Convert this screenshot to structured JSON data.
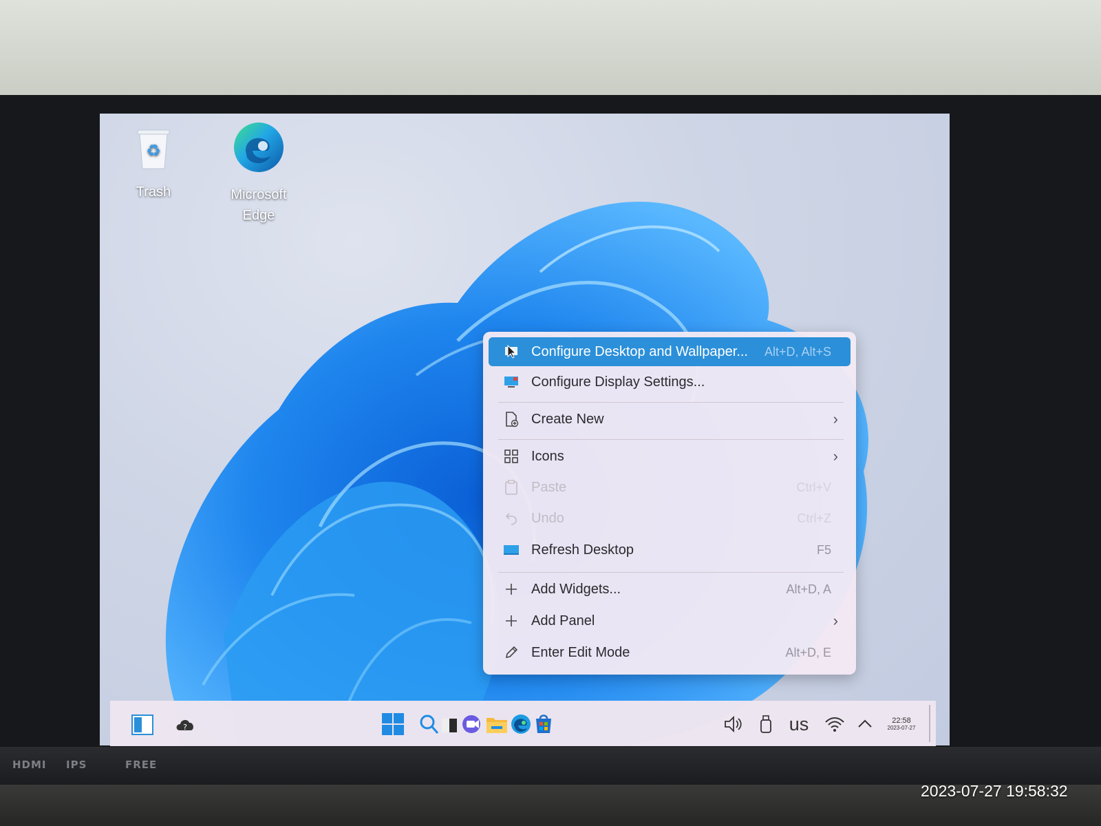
{
  "desktop": {
    "icons": [
      {
        "label": "Trash",
        "icon": "recycle-bin-icon"
      },
      {
        "label": "Microsoft Edge",
        "icon": "edge-icon"
      }
    ]
  },
  "context_menu": {
    "items": [
      {
        "label": "Configure Desktop and Wallpaper...",
        "shortcut": "Alt+D, Alt+S",
        "icon": "desktop-settings-icon",
        "state": "highlighted"
      },
      {
        "label": "Configure Display Settings...",
        "shortcut": "",
        "icon": "display-icon"
      },
      {
        "label": "Create New",
        "shortcut": "",
        "icon": "new-file-icon",
        "submenu": true
      },
      {
        "label": "Icons",
        "shortcut": "",
        "icon": "grid-icon",
        "submenu": true
      },
      {
        "label": "Paste",
        "shortcut": "Ctrl+V",
        "icon": "clipboard-icon",
        "state": "disabled"
      },
      {
        "label": "Undo",
        "shortcut": "Ctrl+Z",
        "icon": "undo-icon",
        "state": "disabled"
      },
      {
        "label": "Refresh Desktop",
        "shortcut": "F5",
        "icon": "refresh-icon"
      },
      {
        "label": "Add Widgets...",
        "shortcut": "Alt+D, A",
        "icon": "plus-icon"
      },
      {
        "label": "Add Panel",
        "shortcut": "",
        "icon": "plus-icon",
        "submenu": true
      },
      {
        "label": "Enter Edit Mode",
        "shortcut": "Alt+D, E",
        "icon": "pencil-icon"
      }
    ],
    "submenu_arrow": "›"
  },
  "taskbar": {
    "keyboard_layout": "us",
    "clock_time": "22:58",
    "clock_date": "2023-07-27"
  },
  "monitor": {
    "labels": [
      "HDMI",
      "IPS",
      "FREE"
    ]
  },
  "photo_timestamp": "2023-07-27 19:58:32",
  "colors": {
    "accent": "#2b8fd9",
    "menu_bg": "#f3e9f4",
    "taskbar_bg": "#eee5f0"
  }
}
